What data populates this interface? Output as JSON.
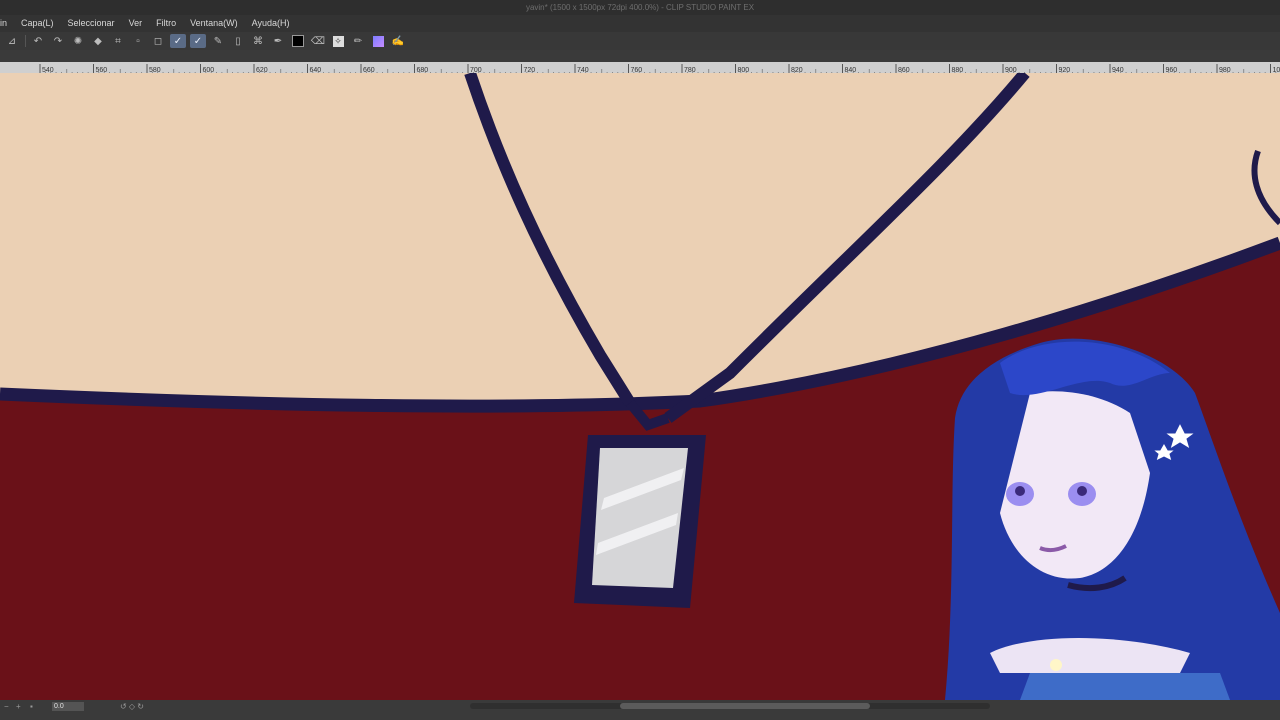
{
  "window": {
    "title": "yavin* (1500 x 1500px 72dpi 400.0%)  - CLIP STUDIO PAINT EX"
  },
  "menu": [
    "in",
    "Capa(L)",
    "Seleccionar",
    "Ver",
    "Filtro",
    "Ventana(W)",
    "Ayuda(H)"
  ],
  "toolbar": {
    "icons": [
      "layer-visibility-icon",
      "undo-icon",
      "redo-icon",
      "spinner-icon",
      "fill-icon",
      "crop-icon",
      "rect-select-icon",
      "shape-icon",
      "stroke-active-icon",
      "stroke-active-2-icon",
      "pen-icon",
      "ruler-icon",
      "lasso-icon",
      "pen-tool-icon",
      "black-swatch-icon",
      "eraser-icon",
      "sparkle-icon",
      "pencil-icon",
      "gradient-icon",
      "purple-pen-icon"
    ]
  },
  "ruler": {
    "labels": [
      "540",
      "560",
      "580",
      "600",
      "620",
      "640",
      "660",
      "680",
      "700",
      "720",
      "740",
      "760",
      "780",
      "800",
      "820",
      "840",
      "860",
      "880",
      "900",
      "920",
      "940",
      "960",
      "980",
      "1000"
    ]
  },
  "status": {
    "zoom": "0.0"
  },
  "colors": {
    "skin": "#ebd0b4",
    "dress": "#6a1118",
    "outline": "#1f1a4a",
    "pendant": "#d6d6d8"
  }
}
